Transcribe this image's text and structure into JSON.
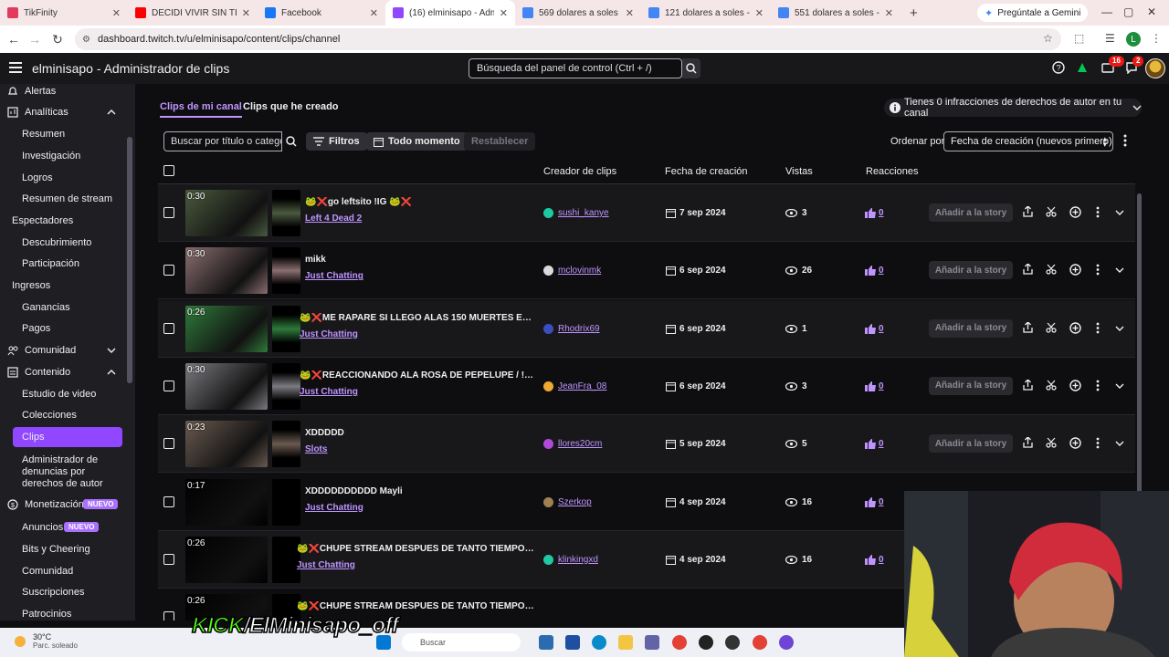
{
  "browser": {
    "tabs": [
      {
        "label": "TikFinity",
        "color": "#e03a5c"
      },
      {
        "label": "DECIDI VIVIR SIN TI - (",
        "color": "#ff0000"
      },
      {
        "label": "Facebook",
        "color": "#1877f2"
      },
      {
        "label": "(16) elminisapo - Administ",
        "color": "#9147ff"
      },
      {
        "label": "569 dolares a soles - Mas",
        "color": "#4285f4"
      },
      {
        "label": "121 dolares a soles - Mas",
        "color": "#4285f4"
      },
      {
        "label": "551 dolares a soles - Mas",
        "color": "#4285f4"
      }
    ],
    "gemini_label": "Pregúntale a Gemini",
    "url": "dashboard.twitch.tv/u/elminisapo/content/clips/channel",
    "profile_initial": "L"
  },
  "header": {
    "title": "elminisapo - Administrador de clips",
    "search_placeholder": "Búsqueda del panel de control (Ctrl + /)",
    "notif_badge_1": "16",
    "notif_badge_2": "2"
  },
  "sidebar": {
    "alertas": "Alertas",
    "analiticas": "Analíticas",
    "resumen": "Resumen",
    "investigacion": "Investigación",
    "logros": "Logros",
    "resumen_stream": "Resumen de stream",
    "espectadores": "Espectadores",
    "descubrimiento": "Descubrimiento",
    "participacion": "Participación",
    "ingresos": "Ingresos",
    "ganancias": "Ganancias",
    "pagos": "Pagos",
    "comunidad": "Comunidad",
    "contenido": "Contenido",
    "estudio_video": "Estudio de video",
    "colecciones": "Colecciones",
    "clips": "Clips",
    "denuncias": "Administrador de denuncias por derechos de autor",
    "monetizacion": "Monetización",
    "nuevo": "NUEVO",
    "anuncios": "Anuncios",
    "bits": "Bits y Cheering",
    "comunidad2": "Comunidad",
    "suscripciones": "Suscripciones",
    "patrocinios": "Patrocinios"
  },
  "main": {
    "tab_mine": "Clips de mi canal",
    "tab_created": "Clips que he creado",
    "copyright_notice": "Tienes 0 infracciones de derechos de autor en tu canal",
    "filter_placeholder": "Buscar por título o categoría",
    "filters": "Filtros",
    "all_time": "Todo momento",
    "reset": "Restablecer",
    "sort_label": "Ordenar por",
    "sort_value": "Fecha de creación (nuevos primero)",
    "columns": {
      "creator": "Creador de clips",
      "date": "Fecha de creación",
      "views": "Vistas",
      "reactions": "Reacciones"
    },
    "story_button": "Añadir a la story",
    "clips": [
      {
        "duration": "0:30",
        "title": "🐸❌go leftsito !IG 🐸❌",
        "game": "Left 4 Dead 2",
        "creator": "sushi_kanye",
        "avatar": "#1fc9a4",
        "date": "7 sep 2024",
        "views": "3",
        "reactions": "0",
        "thumb": "#4a5a3e"
      },
      {
        "duration": "0:30",
        "title": "mikk",
        "game": "Just Chatting",
        "creator": "mclovinmk",
        "avatar": "#d9d9e0",
        "date": "6 sep 2024",
        "views": "26",
        "reactions": "0",
        "thumb": "#8a6e70"
      },
      {
        "duration": "0:26",
        "title": "🐸❌ME RAPARE SI LLEGO ALAS 150 MUERTES EN W...",
        "game": "Just Chatting",
        "creator": "Rhodrix69",
        "avatar": "#3a4fbf",
        "date": "6 sep 2024",
        "views": "1",
        "reactions": "0",
        "thumb": "#2f7a3a"
      },
      {
        "duration": "0:30",
        "title": "🐸❌REACCIONANDO ALA ROSA DE PEPELUPE / !DIS...",
        "game": "Just Chatting",
        "creator": "JeanFra_08",
        "avatar": "#f0a830",
        "date": "6 sep 2024",
        "views": "3",
        "reactions": "0",
        "thumb": "#7a7a80"
      },
      {
        "duration": "0:23",
        "title": "XDDDDD",
        "game": "Slots",
        "creator": "llores20cm",
        "avatar": "#b04ad9",
        "date": "5 sep 2024",
        "views": "5",
        "reactions": "0",
        "thumb": "#6a5a50"
      },
      {
        "duration": "0:17",
        "title": "XDDDDDDDDDD Mayli",
        "game": "Just Chatting",
        "creator": "Szerkop",
        "avatar": "#a08050",
        "date": "4 sep 2024",
        "views": "16",
        "reactions": "0",
        "thumb": "#000000"
      },
      {
        "duration": "0:26",
        "title": "🐸❌CHUPE STREAM DESPUES DE TANTO TIEMPO / !...",
        "game": "Just Chatting",
        "creator": "klinkingxd",
        "avatar": "#1fc9a4",
        "date": "4 sep 2024",
        "views": "16",
        "reactions": "0",
        "thumb": "#000000"
      },
      {
        "duration": "0:26",
        "title": "🐸❌CHUPE STREAM DESPUES DE TANTO TIEMPO / !...",
        "game": "",
        "creator": "",
        "avatar": "#1fc9a4",
        "date": "",
        "views": "",
        "reactions": "",
        "thumb": "#000000"
      }
    ]
  },
  "taskbar": {
    "temp": "30°C",
    "weather": "Parc. soleado",
    "search": "Buscar"
  },
  "overlay": {
    "kick_prefix": "KICK",
    "kick_handle": "/ElMinisapo_off"
  }
}
